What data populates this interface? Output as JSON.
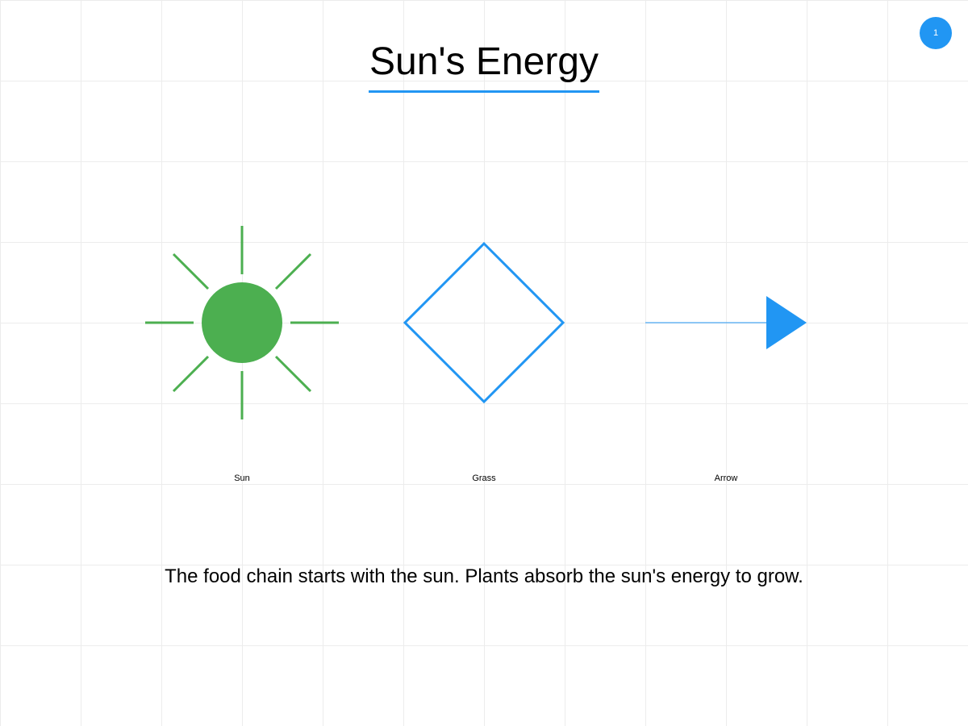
{
  "slide": {
    "title": "Sun's Energy",
    "page_number": "1",
    "caption": "The food chain starts with the sun. Plants absorb the sun's energy to grow."
  },
  "items": [
    {
      "label": "Sun",
      "icon": "sun-icon",
      "color": "#4caf50"
    },
    {
      "label": "Grass",
      "icon": "diamond-outline-icon",
      "color": "#2196f3"
    },
    {
      "label": "Arrow",
      "icon": "arrow-right-icon",
      "color": "#2196f3"
    }
  ],
  "colors": {
    "accent": "#2196f3",
    "green": "#4caf50",
    "grid": "#ececec"
  }
}
